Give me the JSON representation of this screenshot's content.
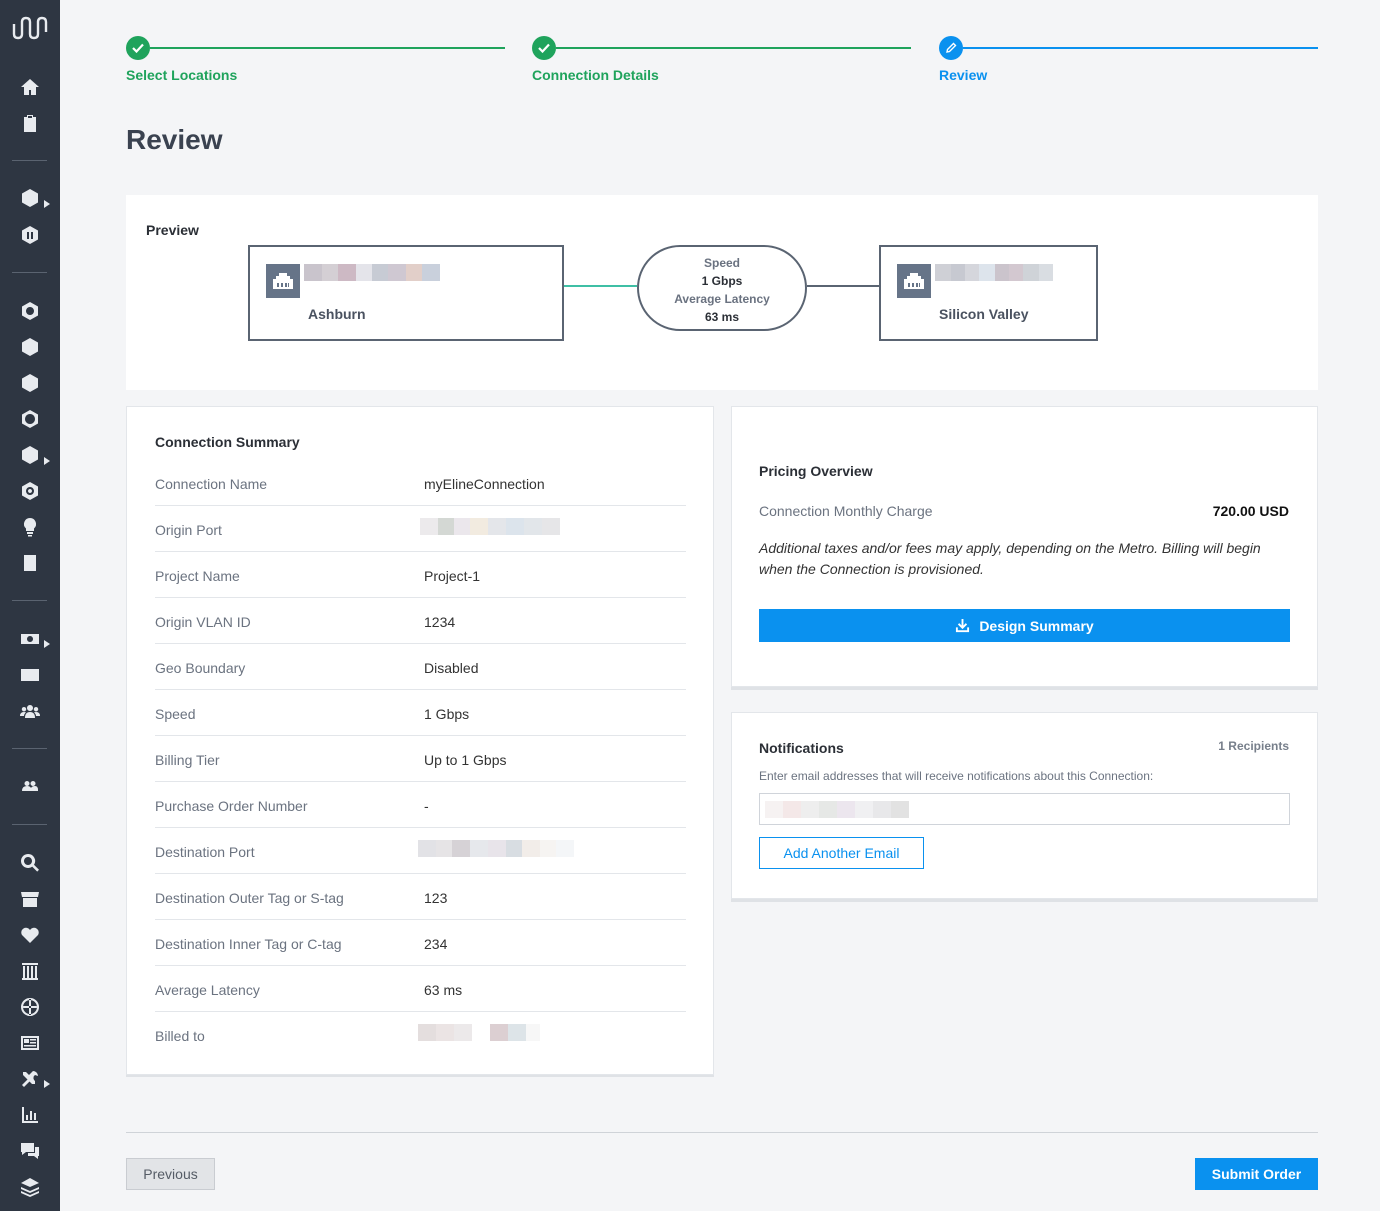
{
  "sidebar": {
    "logo": "equinix-logo",
    "icons": [
      "home-icon",
      "clipboard-icon",
      "fabric-icon",
      "cube-icon",
      "hexagon-network-icon",
      "hexagon-arrow-icon",
      "hexagon-lines-icon",
      "hexagon-globe-icon",
      "stack-icon",
      "power-icon",
      "lightbulb-icon",
      "document-icon",
      "billing-icon",
      "id-card-icon",
      "users-icon",
      "group-icon",
      "search-icon",
      "store-icon",
      "health-icon",
      "datacenter-icon",
      "globe-icon",
      "news-icon",
      "tools-icon",
      "report-icon",
      "chat-icon",
      "layers-icon"
    ]
  },
  "stepper": {
    "steps": [
      {
        "label": "Select Locations",
        "state": "done"
      },
      {
        "label": "Connection Details",
        "state": "done"
      },
      {
        "label": "Review",
        "state": "active"
      }
    ]
  },
  "page": {
    "title": "Review"
  },
  "preview": {
    "title": "Preview",
    "origin": {
      "name": "Ashburn"
    },
    "destination": {
      "name": "Silicon Valley"
    },
    "link": {
      "speed_label": "Speed",
      "speed_value": "1 Gbps",
      "latency_label": "Average Latency",
      "latency_value": "63 ms"
    }
  },
  "summary": {
    "title": "Connection Summary",
    "rows": [
      {
        "label": "Connection Name",
        "value": "myElineConnection"
      },
      {
        "label": "Origin Port",
        "value": ""
      },
      {
        "label": "Project Name",
        "value": "Project-1"
      },
      {
        "label": "Origin VLAN ID",
        "value": "1234"
      },
      {
        "label": "Geo Boundary",
        "value": "Disabled"
      },
      {
        "label": "Speed",
        "value": "1 Gbps"
      },
      {
        "label": "Billing Tier",
        "value": "Up to 1 Gbps"
      },
      {
        "label": "Purchase Order Number",
        "value": "-"
      },
      {
        "label": "Destination Port",
        "value": ""
      },
      {
        "label": "Destination Outer Tag or S-tag",
        "value": "123"
      },
      {
        "label": "Destination Inner Tag or C-tag",
        "value": "234"
      },
      {
        "label": "Average Latency",
        "value": "63 ms"
      },
      {
        "label": "Billed to",
        "value": ""
      }
    ]
  },
  "pricing": {
    "title": "Pricing Overview",
    "charge_label": "Connection Monthly Charge",
    "charge_value": "720.00 USD",
    "note": "Additional taxes and/or fees may apply, depending on the Metro. Billing will begin when the Connection is provisioned.",
    "design_button": "Design Summary"
  },
  "notifications": {
    "title": "Notifications",
    "recipients": "1 Recipients",
    "help": "Enter email addresses that will receive notifications about this Connection:",
    "add_button": "Add Another Email"
  },
  "footer": {
    "previous": "Previous",
    "submit": "Submit Order"
  },
  "colors": {
    "sidebar": "#2e3642",
    "done_green": "#1fa35c",
    "active_blue": "#0a91ef",
    "link_teal": "#3fbfa5"
  }
}
